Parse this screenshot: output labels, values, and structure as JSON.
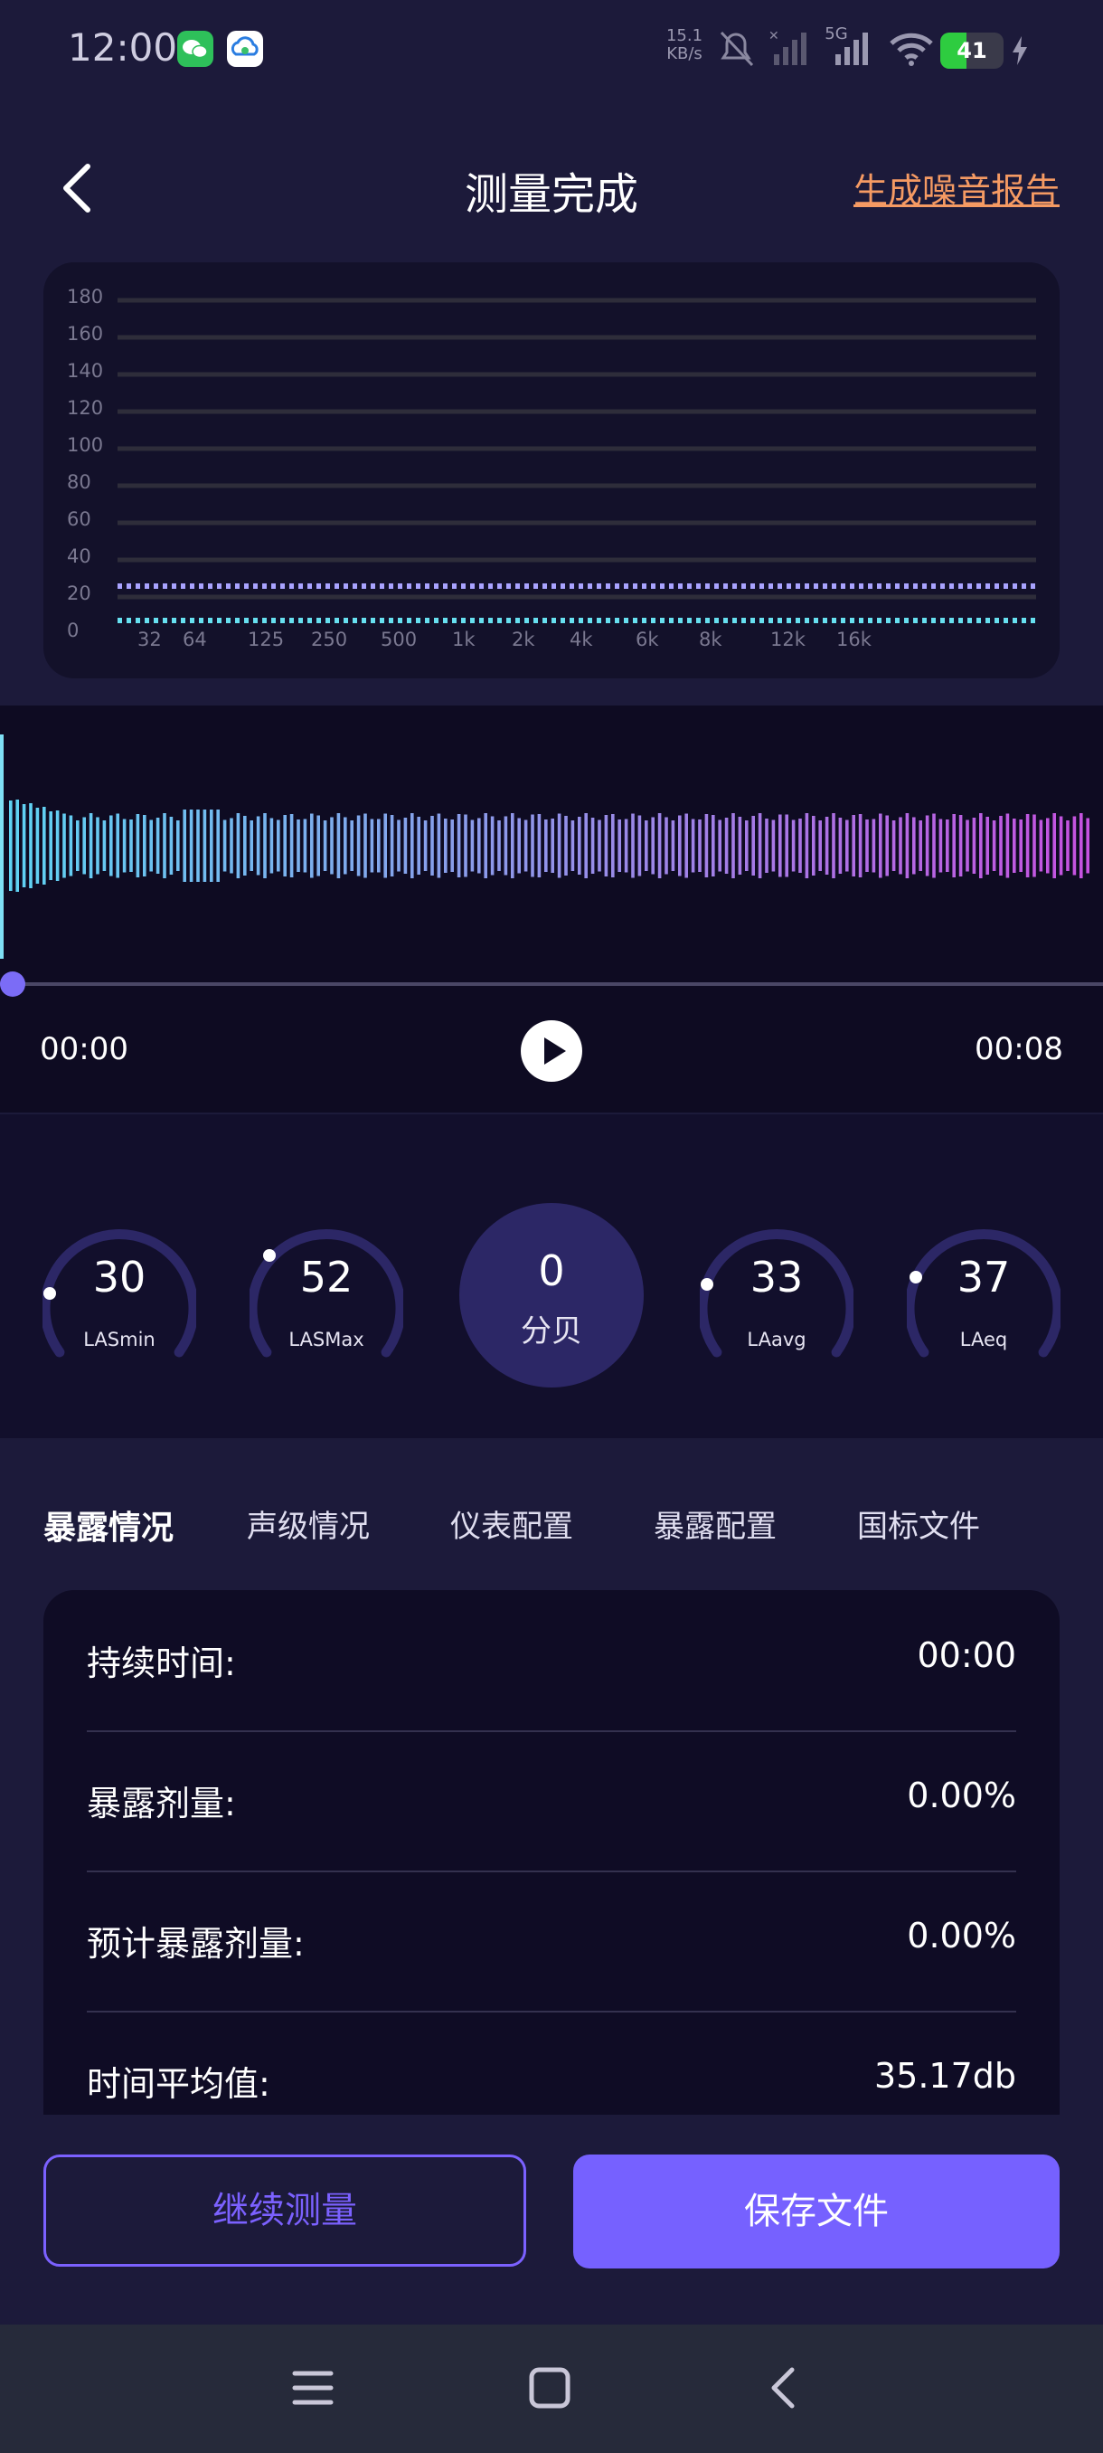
{
  "status_bar": {
    "time": "12:00",
    "net_speed_value": "15.1",
    "net_speed_unit": "KB/s",
    "network": "5G",
    "battery": "41",
    "battery_level": 0.41,
    "icons": [
      "wechat-icon",
      "cloud-icon",
      "mute-icon",
      "signal-icon",
      "wifi-icon",
      "battery-icon",
      "charging-icon"
    ]
  },
  "header": {
    "title": "测量完成",
    "report_link": "生成噪音报告"
  },
  "spectrum": {
    "y_ticks": [
      "180",
      "160",
      "140",
      "120",
      "100",
      "80",
      "60",
      "40",
      "20",
      "0"
    ],
    "x_ticks": [
      "32",
      "64",
      "125",
      "250",
      "500",
      "1k",
      "2k",
      "4k",
      "6k",
      "8k",
      "12k",
      "16k"
    ]
  },
  "player": {
    "current_time": "00:00",
    "total_time": "00:08",
    "progress": 0
  },
  "gauges": [
    {
      "value": "30",
      "label": "LASmin"
    },
    {
      "value": "52",
      "label": "LASMax"
    },
    {
      "value": "33",
      "label": "LAavg"
    },
    {
      "value": "37",
      "label": "LAeq"
    }
  ],
  "center_meter": {
    "value": "0",
    "unit": "分贝"
  },
  "tabs": [
    "暴露情况",
    "声级情况",
    "仪表配置",
    "暴露配置",
    "国标文件"
  ],
  "active_tab": 0,
  "info_rows": [
    {
      "label": "持续时间:",
      "value": "00:00"
    },
    {
      "label": "暴露剂量:",
      "value": "0.00%"
    },
    {
      "label": "预计暴露剂量:",
      "value": "0.00%"
    },
    {
      "label": "时间平均值:",
      "value": "35.17db"
    }
  ],
  "buttons": {
    "continue": "继续测量",
    "save": "保存文件"
  },
  "colors": {
    "background": "#1c1a3a",
    "accent": "#7661ff",
    "report_link": "#f59a63",
    "wave_start": "#5fd3f3",
    "wave_end": "#c652e0"
  }
}
